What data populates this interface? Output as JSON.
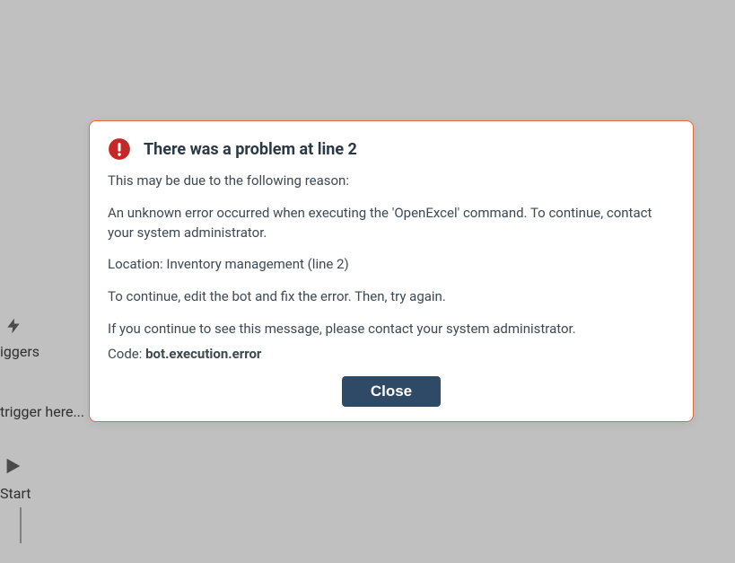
{
  "background": {
    "triggers_label": "iggers",
    "trigger_here": "trigger here...",
    "start_label": "Start"
  },
  "modal": {
    "title": "There was a problem at line 2",
    "intro": "This may be due to the following reason:",
    "reason": "An unknown error occurred when executing the 'OpenExcel' command. To continue, contact your system administrator.",
    "location": "Location: Inventory management (line 2)",
    "instruction": "To continue, edit the bot and fix the error. Then, try again.",
    "persistent": "If you continue to see this message, please contact your system administrator.",
    "code_label": "Code: ",
    "code_value": "bot.execution.error",
    "close_label": "Close"
  }
}
